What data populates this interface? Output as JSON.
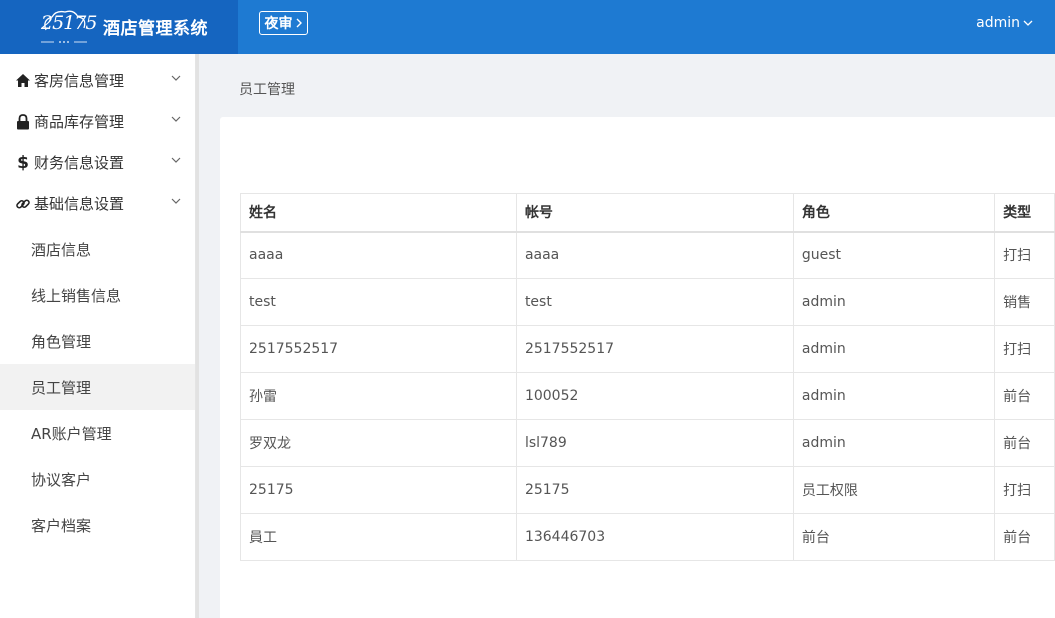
{
  "header": {
    "logo_text": "25175",
    "app_title": "酒店管理系统",
    "night_audit_label": "夜审",
    "user_name": "admin"
  },
  "sidebar": {
    "groups": [
      {
        "label": "客房信息管理",
        "icon": "home-icon"
      },
      {
        "label": "商品库存管理",
        "icon": "lock-icon"
      },
      {
        "label": "财务信息设置",
        "icon": "dollar-icon"
      },
      {
        "label": "基础信息设置",
        "icon": "link-icon"
      }
    ],
    "sub_items": [
      {
        "label": "酒店信息"
      },
      {
        "label": "线上销售信息"
      },
      {
        "label": "角色管理"
      },
      {
        "label": "员工管理",
        "active": true
      },
      {
        "label": "AR账户管理"
      },
      {
        "label": "协议客户"
      },
      {
        "label": "客户档案"
      }
    ]
  },
  "main": {
    "breadcrumb": "员工管理",
    "table": {
      "columns": [
        "姓名",
        "帐号",
        "角色",
        "类型"
      ],
      "rows": [
        [
          "aaaa",
          "aaaa",
          "guest",
          "打扫"
        ],
        [
          "test",
          "test",
          "admin",
          "销售"
        ],
        [
          "2517552517",
          "2517552517",
          "admin",
          "打扫"
        ],
        [
          "孙雷",
          "100052",
          "admin",
          "前台"
        ],
        [
          "罗双龙",
          "lsl789",
          "admin",
          "前台"
        ],
        [
          "25175",
          "25175",
          "员工权限",
          "打扫"
        ],
        [
          "員工",
          "136446703",
          "前台",
          "前台"
        ]
      ]
    }
  },
  "colors": {
    "header_bg": "#1e7ad2",
    "logo_bg": "#1565c0"
  }
}
